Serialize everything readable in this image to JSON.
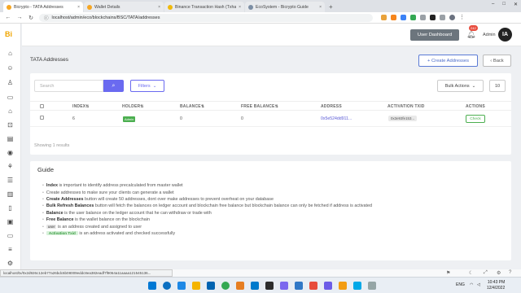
{
  "browser": {
    "tabs": [
      {
        "title": "Bicrypto - TATA Addresses",
        "active": true
      },
      {
        "title": "Wallet Details",
        "active": false
      },
      {
        "title": "Binance Transaction Hash (Txhash...",
        "active": false
      },
      {
        "title": "EcoSystem - Bicrypto Guide",
        "active": false
      }
    ],
    "url": "localhost/admin/eco/blockchains/BSC/TATA/addresses",
    "new_tab": "+",
    "close": "×"
  },
  "sidebar": {
    "logo": "Bi",
    "icons": [
      "home-icon",
      "users-icon",
      "user-icon",
      "briefcase-icon",
      "bank-icon",
      "cart-icon",
      "chart-icon",
      "coins-icon",
      "network-icon",
      "filter-icon",
      "building-icon",
      "book-icon",
      "wallet-icon",
      "card-icon",
      "list-icon",
      "settings-icon"
    ]
  },
  "header": {
    "user_dashboard": "User Dashboard",
    "notifications_count": "242",
    "admin_label": "Admin",
    "avatar_initials": "IA"
  },
  "page": {
    "title": "TATA Addresses",
    "create_button": "+ Create Addresses",
    "back_button": "‹ Back"
  },
  "toolbar": {
    "search_placeholder": "Search",
    "filters_label": "Filters",
    "bulk_actions_label": "Bulk Actions",
    "per_page": "10"
  },
  "table": {
    "columns": [
      "INDEX⇅",
      "HOLDER⇅",
      "BALANCE⇅",
      "FREE BALANCE⇅",
      "ADDRESS",
      "ACTIVATION TXID",
      "ACTIONS"
    ],
    "rows": [
      {
        "index": "6",
        "holder": "Admin",
        "balance": "0",
        "free_balance": "0",
        "address": "0x5e524dd911...",
        "activation_txid": "0x3e93fe153...",
        "action": "Check"
      }
    ],
    "showing": "Showing 1 results"
  },
  "guide": {
    "title": "Guide",
    "items": [
      {
        "bold": "Index",
        "text": " is important to identify address precalculated from master wallet"
      },
      {
        "bold": "",
        "text": "Create addresses to make sure your clients can generate a wallet"
      },
      {
        "bold": "Create Addresses",
        "text": " button will create 50 addresses, dont over make addresses to prevent overheat on your database"
      },
      {
        "bold": "Bulk Refresh Balances",
        "text": " button will fetch the balances on ledger account and blockchain free balance but blockchain balance can only be fetched if address is activated"
      },
      {
        "bold": "Balance",
        "text": " is the user balance on the ledger account that he can withdraw or trade with"
      },
      {
        "bold": "Free Balance",
        "text": " is the wallet balance on the blockchain"
      },
      {
        "badge": "user",
        "text": " is an address created and assigned to user"
      },
      {
        "badge": "Activation Txid",
        "text": " is an address activated and checked successfully"
      }
    ]
  },
  "status_bar_url": "localhost/tx/0x2d926c12eb77a26bdc6b08009eddc8ea382eadf7f9064a11aaaa121545136...",
  "system": {
    "lang": "ENG",
    "time": "10:43 PM",
    "date": "12/4/2022"
  }
}
